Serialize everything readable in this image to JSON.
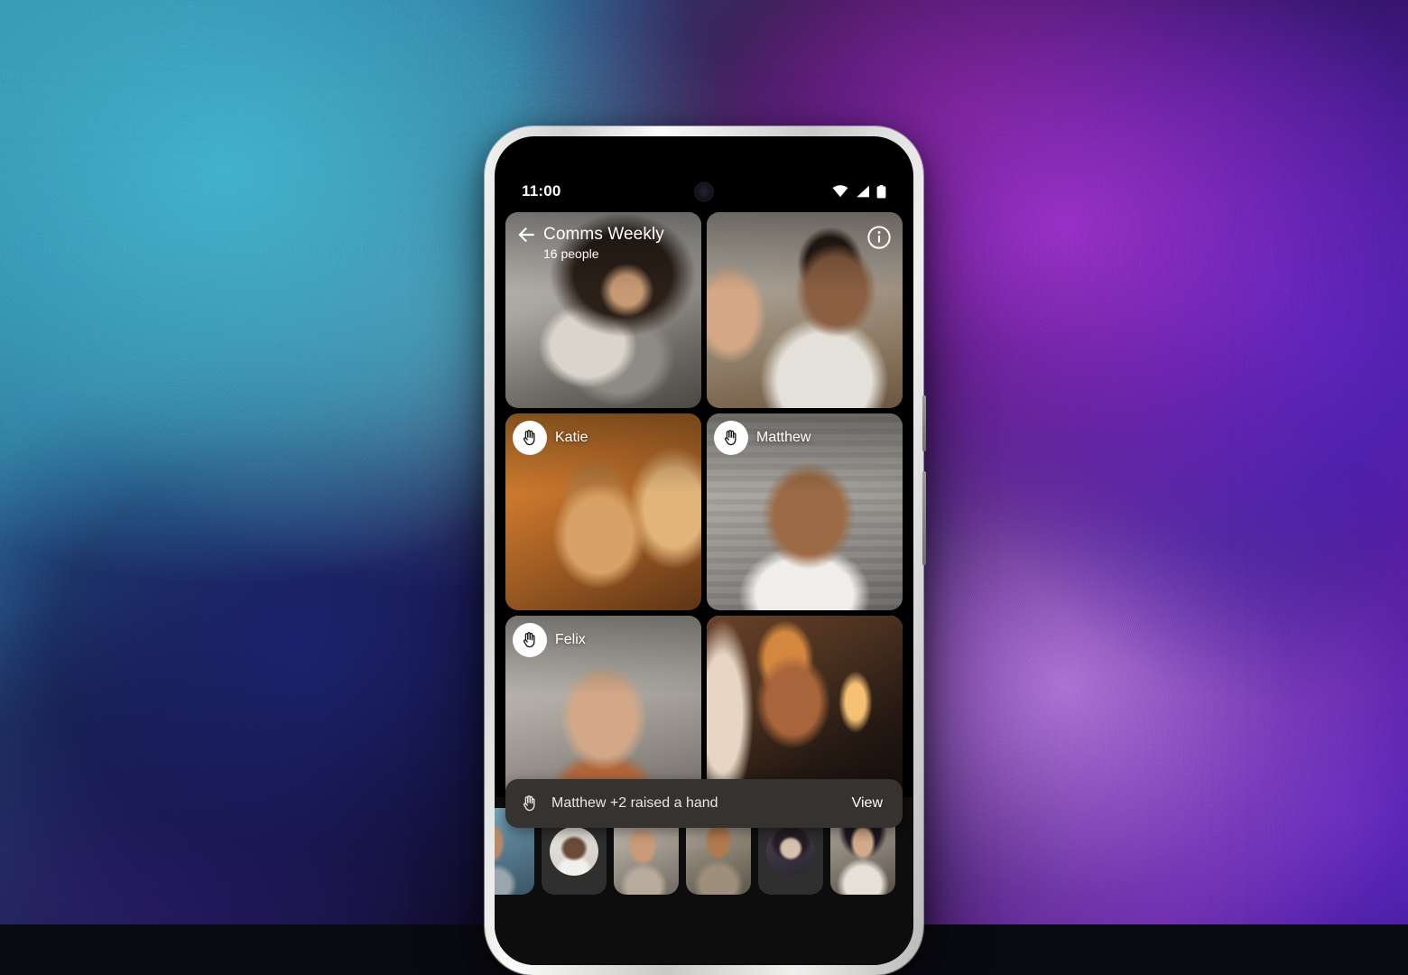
{
  "background": {
    "colors": [
      "#2f8fa8",
      "#201a52",
      "#4a1470",
      "#7b22b8",
      "#3a1ba8"
    ]
  },
  "device": {
    "frame_color": "#e8e8e6",
    "screen_color": "#000000",
    "camera_icon": "punchhole-camera-icon",
    "power_button": "power-button",
    "volume_button": "volume-button"
  },
  "status_bar": {
    "time": "11:00",
    "icons": [
      "wifi-icon",
      "cellular-signal-icon",
      "battery-icon"
    ]
  },
  "call": {
    "back_icon": "back-arrow-icon",
    "title": "Comms Weekly",
    "subtitle": "16 people",
    "info_icon": "info-icon"
  },
  "tiles": [
    {
      "name": "",
      "photo": "ph-cat",
      "hand_raised": false,
      "active": false,
      "has_header": true,
      "has_info": false
    },
    {
      "name": "",
      "photo": "ph-wave",
      "hand_raised": false,
      "active": false,
      "has_header": false,
      "has_info": true
    },
    {
      "name": "Katie",
      "photo": "ph-katie",
      "hand_raised": true,
      "active": false,
      "has_header": false,
      "has_info": false
    },
    {
      "name": "Matthew",
      "photo": "ph-matthew",
      "hand_raised": true,
      "active": false,
      "has_header": false,
      "has_info": false
    },
    {
      "name": "Felix",
      "photo": "ph-felix",
      "hand_raised": true,
      "active": false,
      "has_header": false,
      "has_info": false
    },
    {
      "name": "",
      "photo": "ph-neon",
      "hand_raised": false,
      "active": true,
      "has_header": false,
      "has_info": false
    }
  ],
  "snackbar": {
    "icon": "raised-hand-icon",
    "message": "Matthew +2 raised a hand",
    "action_label": "View",
    "background_color": "#36322f"
  },
  "filmstrip": {
    "background_color": "#0d0d0d",
    "thumbnails": [
      {
        "kind": "video",
        "photo": "tv-1",
        "label": ""
      },
      {
        "kind": "avatar",
        "photo": "av-1",
        "label": ""
      },
      {
        "kind": "video",
        "photo": "tv-2",
        "label": ""
      },
      {
        "kind": "video",
        "photo": "tv-3",
        "label": ""
      },
      {
        "kind": "avatar",
        "photo": "av-2",
        "label": ""
      },
      {
        "kind": "video",
        "photo": "tv-4",
        "label": ""
      }
    ]
  }
}
